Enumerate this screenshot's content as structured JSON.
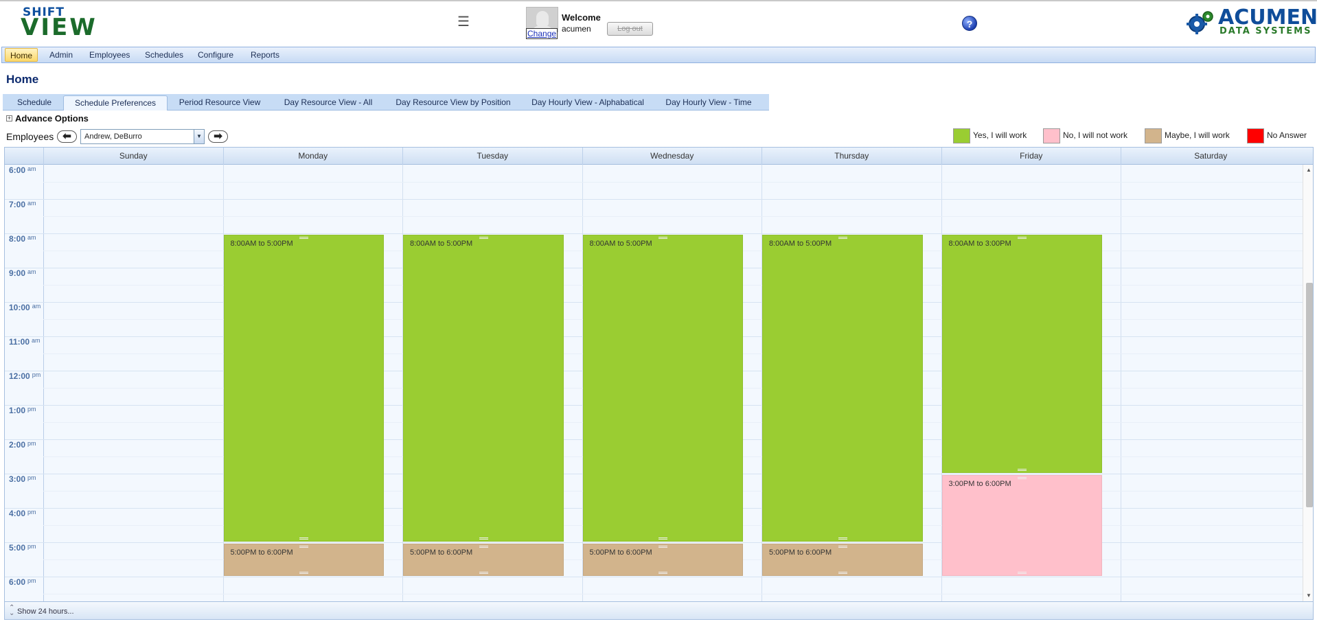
{
  "header": {
    "logo_top": "SHIFT",
    "logo_bottom": "VIEW",
    "menu_icon": "☰",
    "change_link": "Change",
    "welcome": "Welcome",
    "username": "acumen",
    "logout": "Log out",
    "help": "?",
    "brand_name": "ACUMEN",
    "brand_sub": "DATA SYSTEMS"
  },
  "nav": {
    "items": [
      {
        "label": "Home",
        "active": true
      },
      {
        "label": "Admin",
        "active": false
      },
      {
        "label": "Employees",
        "active": false
      },
      {
        "label": "Schedules",
        "active": false
      },
      {
        "label": "Configure",
        "active": false
      },
      {
        "label": "Reports",
        "active": false
      }
    ]
  },
  "page": {
    "title": "Home"
  },
  "tabs": [
    {
      "label": "Schedule",
      "active": false
    },
    {
      "label": "Schedule Preferences",
      "active": true
    },
    {
      "label": "Period Resource View",
      "active": false
    },
    {
      "label": "Day Resource View - All",
      "active": false
    },
    {
      "label": "Day Resource View by Position",
      "active": false
    },
    {
      "label": "Day Hourly View - Alphabatical",
      "active": false
    },
    {
      "label": "Day Hourly View - Time",
      "active": false
    }
  ],
  "advance_options": {
    "toggle": "+",
    "label": "Advance Options"
  },
  "employees": {
    "label": "Employees",
    "selected": "Andrew, DeBurro",
    "prev_icon": "⬅",
    "next_icon": "➡",
    "dropdown_icon": "▼"
  },
  "legend": [
    {
      "label": "Yes, I will work",
      "color": "#9acd32"
    },
    {
      "label": "No, I will not work",
      "color": "#ffc0cb"
    },
    {
      "label": "Maybe, I will work",
      "color": "#d2b48c"
    },
    {
      "label": "No Answer",
      "color": "#ff0000"
    }
  ],
  "calendar": {
    "days": [
      "Sunday",
      "Monday",
      "Tuesday",
      "Wednesday",
      "Thursday",
      "Friday",
      "Saturday"
    ],
    "hours": [
      {
        "h": "6:00",
        "ap": "am"
      },
      {
        "h": "7:00",
        "ap": "am"
      },
      {
        "h": "8:00",
        "ap": "am"
      },
      {
        "h": "9:00",
        "ap": "am"
      },
      {
        "h": "10:00",
        "ap": "am"
      },
      {
        "h": "11:00",
        "ap": "am"
      },
      {
        "h": "12:00",
        "ap": "pm"
      },
      {
        "h": "1:00",
        "ap": "pm"
      },
      {
        "h": "2:00",
        "ap": "pm"
      },
      {
        "h": "3:00",
        "ap": "pm"
      },
      {
        "h": "4:00",
        "ap": "pm"
      },
      {
        "h": "5:00",
        "ap": "pm"
      },
      {
        "h": "6:00",
        "ap": "pm"
      }
    ],
    "first_hour": 6,
    "appointments": [
      {
        "day": 1,
        "start": 8,
        "end": 17,
        "label": "8:00AM to 5:00PM",
        "status": "yes"
      },
      {
        "day": 1,
        "start": 17,
        "end": 18,
        "label": "5:00PM to 6:00PM",
        "status": "maybe"
      },
      {
        "day": 2,
        "start": 8,
        "end": 17,
        "label": "8:00AM to 5:00PM",
        "status": "yes"
      },
      {
        "day": 2,
        "start": 17,
        "end": 18,
        "label": "5:00PM to 6:00PM",
        "status": "maybe"
      },
      {
        "day": 3,
        "start": 8,
        "end": 17,
        "label": "8:00AM to 5:00PM",
        "status": "yes"
      },
      {
        "day": 3,
        "start": 17,
        "end": 18,
        "label": "5:00PM to 6:00PM",
        "status": "maybe"
      },
      {
        "day": 4,
        "start": 8,
        "end": 17,
        "label": "8:00AM to 5:00PM",
        "status": "yes"
      },
      {
        "day": 4,
        "start": 17,
        "end": 18,
        "label": "5:00PM to 6:00PM",
        "status": "maybe"
      },
      {
        "day": 5,
        "start": 8,
        "end": 15,
        "label": "8:00AM to 3:00PM",
        "status": "yes"
      },
      {
        "day": 5,
        "start": 15,
        "end": 18,
        "label": "3:00PM to 6:00PM",
        "status": "no"
      }
    ],
    "status_colors": {
      "yes": "#9acd32",
      "maybe": "#d2b48c",
      "no": "#ffc0cb"
    },
    "scroll_position": 0.27,
    "footer": "Show 24 hours..."
  }
}
